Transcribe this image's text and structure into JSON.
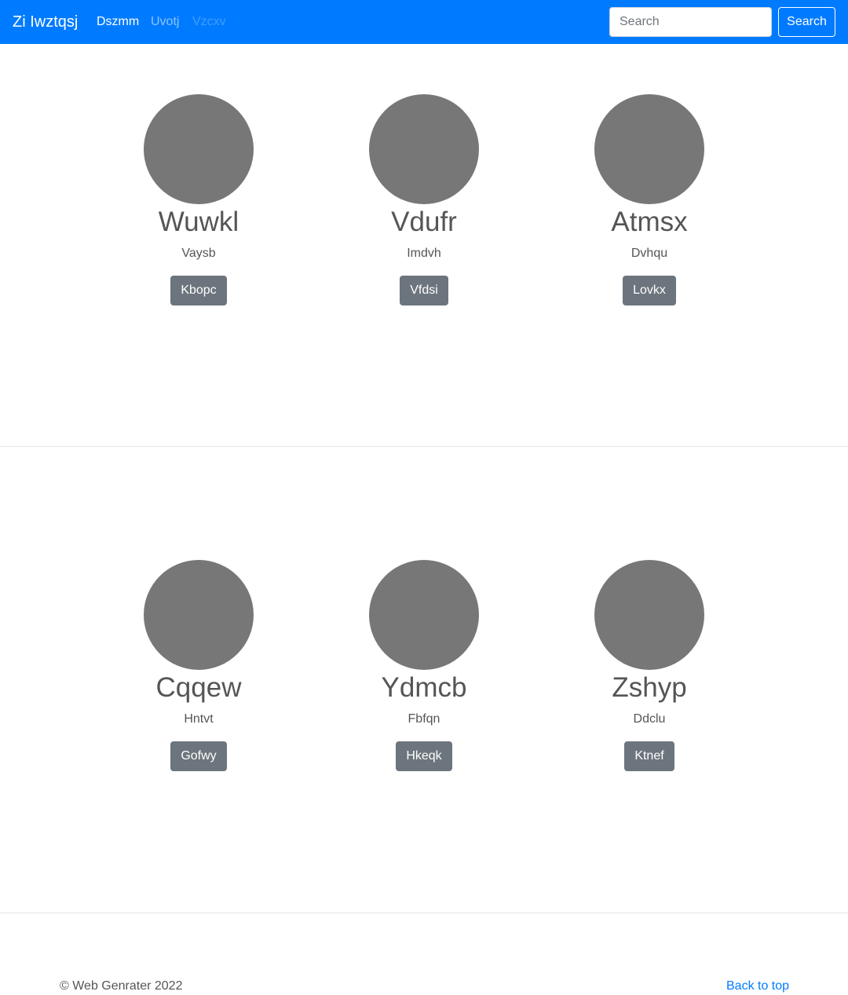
{
  "navbar": {
    "brand": "Zi Iwztqsj",
    "links": [
      {
        "label": "Dszmm",
        "state": "active"
      },
      {
        "label": "Uvotj",
        "state": "normal"
      },
      {
        "label": "Vzcxv",
        "state": "disabled"
      }
    ],
    "search": {
      "placeholder": "Search",
      "value": ""
    },
    "search_button": "Search",
    "bg_color": "#007bff"
  },
  "sections": [
    {
      "items": [
        {
          "title": "Wuwkl",
          "subtitle": "Vaysb",
          "button": "Kbopc"
        },
        {
          "title": "Vdufr",
          "subtitle": "Imdvh",
          "button": "Vfdsi"
        },
        {
          "title": "Atmsx",
          "subtitle": "Dvhqu",
          "button": "Lovkx"
        }
      ]
    },
    {
      "items": [
        {
          "title": "Cqqew",
          "subtitle": "Hntvt",
          "button": "Gofwy"
        },
        {
          "title": "Ydmcb",
          "subtitle": "Fbfqn",
          "button": "Hkeqk"
        },
        {
          "title": "Zshyp",
          "subtitle": "Ddclu",
          "button": "Ktnef"
        }
      ]
    }
  ],
  "footer": {
    "copyright": "© Web Genrater 2022",
    "back_to_top": "Back to top"
  }
}
